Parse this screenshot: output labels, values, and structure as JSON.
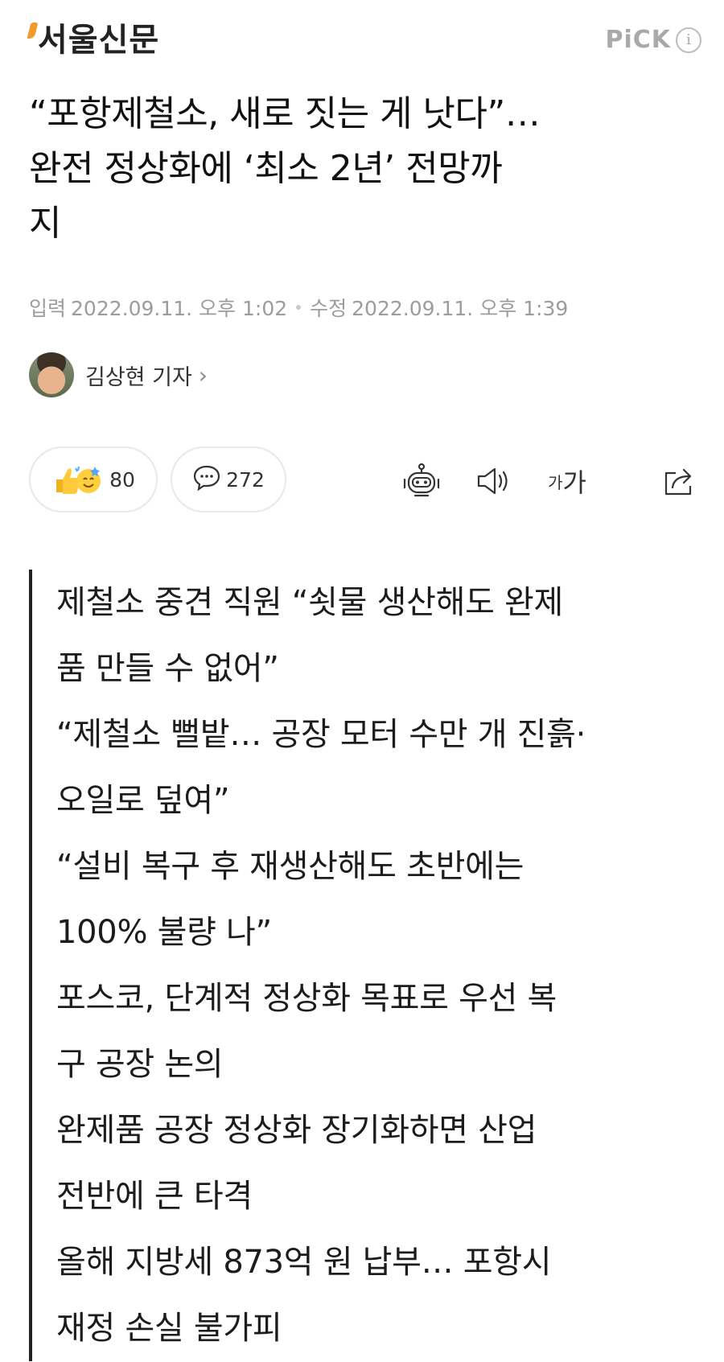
{
  "header": {
    "brand": "서울신문",
    "pick_label": "PiCK",
    "info_icon": "info-icon"
  },
  "headline": {
    "lines": [
      "“포항제철소, 새로 짓는 게 낫다”…",
      "완전 정상화에 ‘최소 2년’ 전망까",
      "지"
    ]
  },
  "dates": {
    "input_label": "입력",
    "input_value": "2022.09.11. 오후 1:02",
    "edit_label": "수정",
    "edit_value": "2022.09.11. 오후 1:39"
  },
  "reporter": {
    "name": "김상현 기자",
    "chevron": "›"
  },
  "actions": {
    "reaction_count": "80",
    "comment_count": "272",
    "font_size_small": "가",
    "font_size_large": "가",
    "icons": [
      "reaction-icon",
      "comment-icon",
      "summary-bot-icon",
      "speaker-icon",
      "font-size-icon",
      "share-icon"
    ]
  },
  "summary": {
    "lines": [
      "제철소 중견 직원 “쇳물 생산해도 완제",
      "품 만들 수 없어”",
      "“제철소 뻘밭… 공장 모터 수만 개 진흙·",
      "오일로 덮여”",
      "“설비 복구 후 재생산해도 초반에는",
      "100% 불량 나”",
      "포스코, 단계적 정상화 목표로 우선 복",
      "구 공장 논의",
      "완제품 공장 정상화 장기화하면 산업",
      "전반에 큰 타격",
      "올해 지방세 873억 원 납부… 포항시",
      "재정 손실 불가피"
    ]
  },
  "colors": {
    "brand_accent": "#f29a2e",
    "muted_text": "#9c9c9c",
    "border": "#e8e8e8"
  }
}
